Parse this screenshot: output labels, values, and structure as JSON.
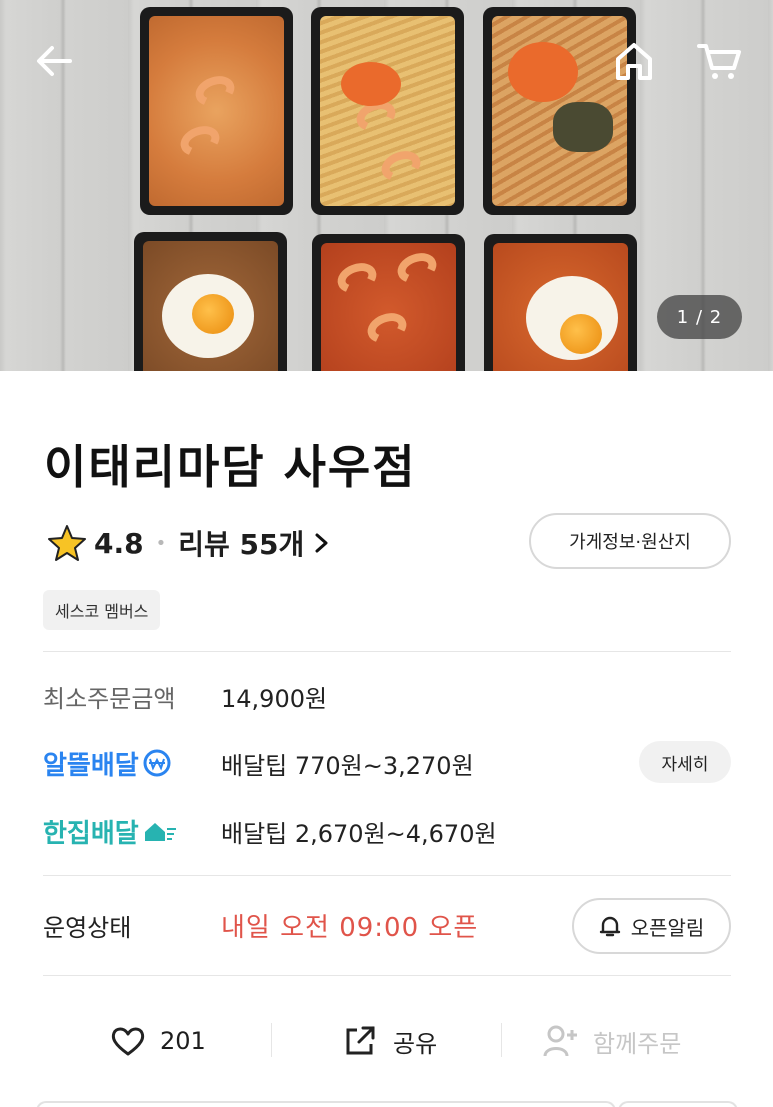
{
  "hero": {
    "pager": "1 / 2"
  },
  "store": {
    "name": "이태리마담 사우점",
    "rating": "4.8",
    "reviews_label": "리뷰 55개",
    "info_button": "가게정보·원산지",
    "tag": "세스코 멤버스"
  },
  "info": {
    "min_order_label": "최소주문금액",
    "min_order_value": "14,900원",
    "saver_delivery_label": "알뜰배달",
    "saver_delivery_value": "배달팁 770원~3,270원",
    "detail_button": "자세히",
    "single_delivery_label": "한집배달",
    "single_delivery_value": "배달팁 2,670원~4,670원"
  },
  "status": {
    "label": "운영상태",
    "value": "내일 오전 09:00 오픈",
    "alarm_button": "오픈알림"
  },
  "actions": {
    "like_count": "201",
    "share_label": "공유",
    "group_order_label": "함께주문"
  },
  "colors": {
    "saver_brand": "#2a84f0",
    "single_brand": "#27b3b1",
    "status_red": "#e0544a"
  },
  "icons": [
    "back-arrow-icon",
    "home-icon",
    "cart-icon",
    "star-icon",
    "chevron-right-icon",
    "bell-icon",
    "heart-icon",
    "share-icon",
    "person-add-icon"
  ]
}
